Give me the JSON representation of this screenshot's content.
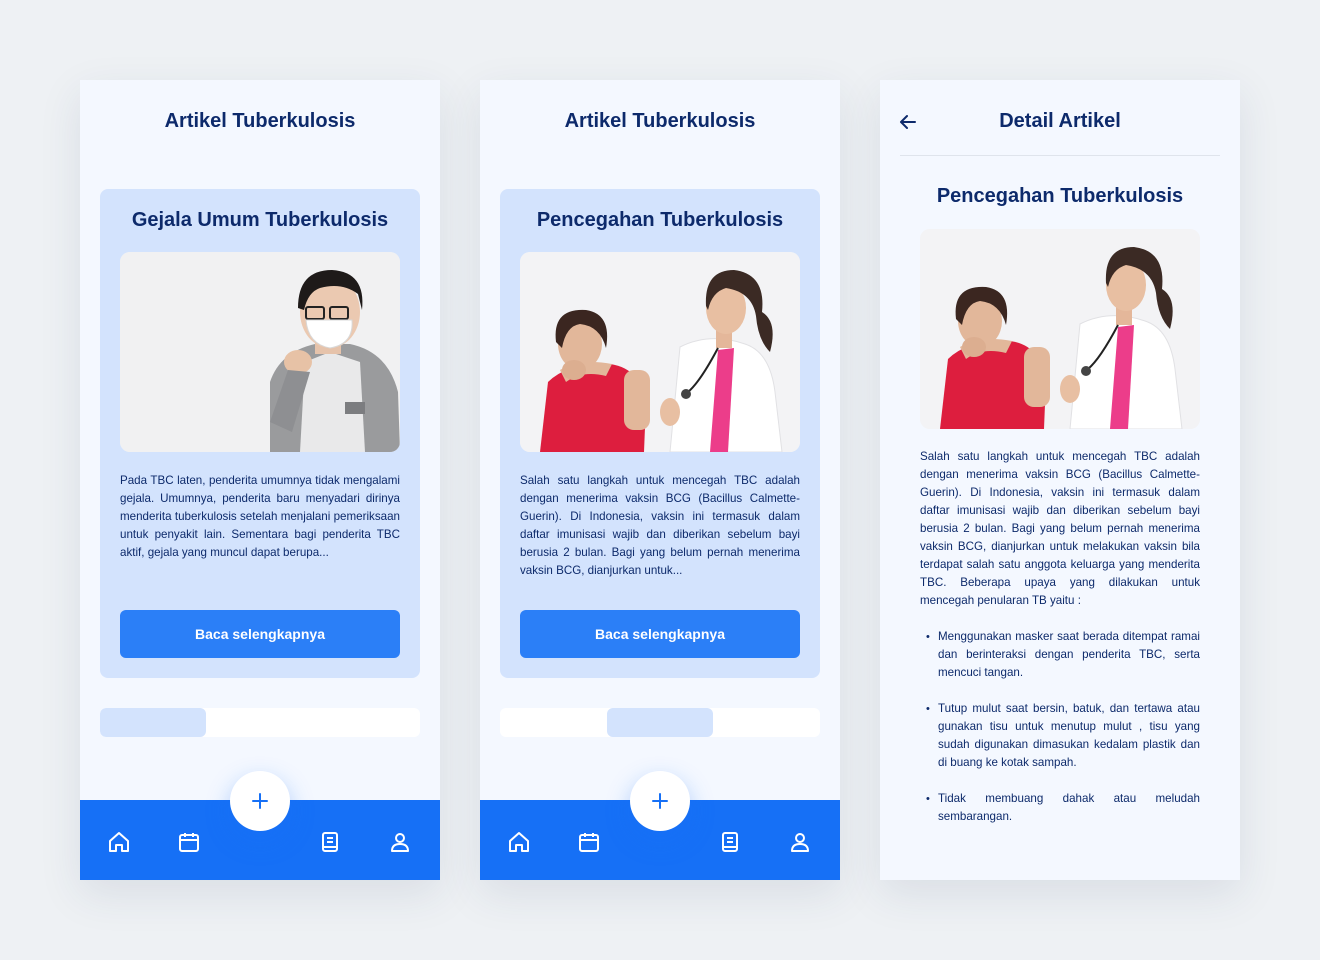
{
  "screens": [
    {
      "app_title": "Artikel Tuberkulosis",
      "card": {
        "title": "Gejala Umum Tuberkulosis",
        "excerpt": "Pada TBC laten, penderita umumnya tidak mengalami gejala. Umumnya, penderita baru menyadari dirinya menderita tuberkulosis setelah menjalani pemeriksaan untuk penyakit lain. Sementara bagi penderita TBC aktif, gejala yang muncul dapat berupa...",
        "button_label": "Baca selengkapnya"
      },
      "pager": {
        "count": 3,
        "active_index": 0
      },
      "nav_icons": [
        "home-icon",
        "calendar-icon",
        "plus-icon",
        "book-icon",
        "user-icon"
      ],
      "fab_label": "+"
    },
    {
      "app_title": "Artikel Tuberkulosis",
      "card": {
        "title": "Pencegahan Tuberkulosis",
        "excerpt": "Salah satu langkah untuk mencegah TBC adalah dengan menerima vaksin BCG (Bacillus Calmette-Guerin). Di Indonesia, vaksin ini termasuk dalam daftar imunisasi wajib dan diberikan sebelum bayi berusia 2 bulan. Bagi yang belum pernah menerima vaksin BCG, dianjurkan untuk...",
        "button_label": "Baca selengkapnya"
      },
      "pager": {
        "count": 3,
        "active_index": 1
      },
      "nav_icons": [
        "home-icon",
        "calendar-icon",
        "plus-icon",
        "book-icon",
        "user-icon"
      ],
      "fab_label": "+"
    }
  ],
  "detail": {
    "header_title": "Detail Artikel",
    "back_icon": "arrow-left-icon",
    "article_title": "Pencegahan Tuberkulosis",
    "body": "Salah satu langkah untuk mencegah TBC adalah dengan menerima vaksin BCG (Bacillus Calmette-Guerin). Di Indonesia, vaksin ini termasuk dalam daftar imunisasi wajib dan diberikan sebelum bayi berusia 2 bulan. Bagi yang belum pernah menerima vaksin BCG, dianjurkan untuk melakukan vaksin bila terdapat salah satu anggota keluarga yang menderita TBC. Beberapa upaya yang dilakukan untuk mencegah penularan TB yaitu :",
    "bullets": [
      "Menggunakan masker saat berada ditempat ramai dan berinteraksi dengan penderita TBC, serta mencuci tangan.",
      "Tutup mulut saat bersin, batuk, dan tertawa atau gunakan tisu untuk menutup mulut , tisu yang sudah digunakan  dimasukan kedalam plastik dan di buang ke kotak sampah.",
      "Tidak membuang dahak atau meludah sembarangan."
    ],
    "bullet_char": "•"
  },
  "colors": {
    "background": "#eef1f4",
    "screen": "#f4f8ff",
    "card": "#d3e3fd",
    "primary": "#2b7ff7",
    "nav": "#1670f6",
    "text": "#0d2a6b"
  }
}
